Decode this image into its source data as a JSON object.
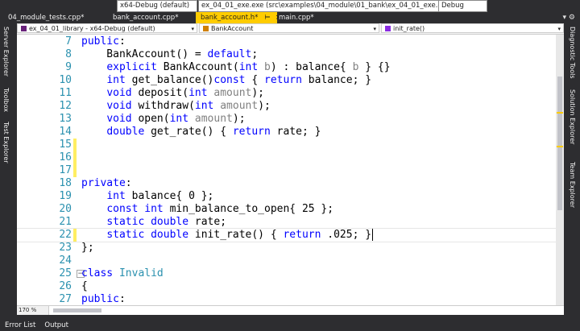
{
  "top_bar": {
    "platform": "x64-Debug (default)",
    "startup_item": "ex_04_01_exe.exe (src\\examples\\04_module\\01_bank\\ex_04_01_exe.exe)",
    "config": "Debug"
  },
  "tabs": [
    {
      "label": "04_module_tests.cpp*",
      "active": false
    },
    {
      "label": "bank_account.cpp*",
      "active": false
    },
    {
      "label": "bank_account.h*",
      "active": true,
      "pin": "⊨",
      "close": "×"
    },
    {
      "label": "main.cpp*",
      "active": false
    }
  ],
  "tab_overflow": "▾ ⚙",
  "left_sidebar": [
    "Server Explorer",
    "Toolbox",
    "Test Explorer"
  ],
  "right_sidebar": [
    "Diagnostic Tools",
    "Solution Explorer",
    "Team Explorer"
  ],
  "navigation": {
    "project": "ex_04_01_library - x64-Debug (default)",
    "class": "BankAccount",
    "member": "init_rate()"
  },
  "editor": {
    "lines": [
      {
        "n": "7",
        "tokens": [
          [
            "kw",
            "public"
          ],
          [
            "",
            ":"
          ]
        ]
      },
      {
        "n": "8",
        "tokens": [
          [
            "",
            "    BankAccount() = "
          ],
          [
            "kw",
            "default"
          ],
          [
            "",
            ";"
          ]
        ]
      },
      {
        "n": "9",
        "tokens": [
          [
            "",
            "    "
          ],
          [
            "kw",
            "explicit"
          ],
          [
            "",
            " BankAccount("
          ],
          [
            "kw",
            "int"
          ],
          [
            "",
            ""
          ],
          [
            "pm",
            " b"
          ],
          [
            "",
            ") : balance{ "
          ],
          [
            "pm",
            "b"
          ],
          [
            "",
            " } {}"
          ]
        ]
      },
      {
        "n": "10",
        "tokens": [
          [
            "",
            "    "
          ],
          [
            "kw",
            "int"
          ],
          [
            "",
            " get_balance()"
          ],
          [
            "kw",
            "const"
          ],
          [
            "",
            " { "
          ],
          [
            "kw",
            "return"
          ],
          [
            "",
            " balance; }"
          ]
        ]
      },
      {
        "n": "11",
        "tokens": [
          [
            "",
            "    "
          ],
          [
            "kw",
            "void"
          ],
          [
            "",
            " deposit("
          ],
          [
            "kw",
            "int"
          ],
          [
            "pm",
            " amount"
          ],
          [
            "",
            ");"
          ]
        ]
      },
      {
        "n": "12",
        "tokens": [
          [
            "",
            "    "
          ],
          [
            "kw",
            "void"
          ],
          [
            "",
            " withdraw("
          ],
          [
            "kw",
            "int"
          ],
          [
            "pm",
            " amount"
          ],
          [
            "",
            ");"
          ]
        ]
      },
      {
        "n": "13",
        "tokens": [
          [
            "",
            "    "
          ],
          [
            "kw",
            "void"
          ],
          [
            "",
            " open("
          ],
          [
            "kw",
            "int"
          ],
          [
            "pm",
            " amount"
          ],
          [
            "",
            ");"
          ]
        ]
      },
      {
        "n": "14",
        "tokens": [
          [
            "",
            "    "
          ],
          [
            "kw",
            "double"
          ],
          [
            "",
            " get_rate() { "
          ],
          [
            "kw",
            "return"
          ],
          [
            "",
            " rate; }"
          ]
        ]
      },
      {
        "n": "15",
        "tokens": []
      },
      {
        "n": "16",
        "tokens": []
      },
      {
        "n": "17",
        "tokens": []
      },
      {
        "n": "18",
        "tokens": [
          [
            "kw",
            "private"
          ],
          [
            "",
            ":"
          ]
        ]
      },
      {
        "n": "19",
        "tokens": [
          [
            "",
            "    "
          ],
          [
            "kw",
            "int"
          ],
          [
            "",
            " balance{ 0 };"
          ]
        ]
      },
      {
        "n": "20",
        "tokens": [
          [
            "",
            "    "
          ],
          [
            "kw",
            "const"
          ],
          [
            "",
            " "
          ],
          [
            "kw",
            "int"
          ],
          [
            "",
            " min_balance_to_open{ 25 };"
          ]
        ]
      },
      {
        "n": "21",
        "tokens": [
          [
            "",
            "    "
          ],
          [
            "kw",
            "static"
          ],
          [
            "",
            " "
          ],
          [
            "kw",
            "double"
          ],
          [
            "",
            " rate;"
          ]
        ]
      },
      {
        "n": "22",
        "tokens": [
          [
            "",
            "    "
          ],
          [
            "kw",
            "static"
          ],
          [
            "",
            " "
          ],
          [
            "kw",
            "double"
          ],
          [
            "",
            " init_rate() { "
          ],
          [
            "kw",
            "return"
          ],
          [
            "",
            " .025; }"
          ]
        ]
      },
      {
        "n": "23",
        "tokens": [
          [
            "",
            "};"
          ]
        ]
      },
      {
        "n": "24",
        "tokens": []
      },
      {
        "n": "25",
        "tokens": [
          [
            "kw",
            "class"
          ],
          [
            "",
            " "
          ],
          [
            "ty",
            "Invalid"
          ]
        ]
      },
      {
        "n": "26",
        "tokens": [
          [
            "",
            "{"
          ]
        ]
      },
      {
        "n": "27",
        "tokens": [
          [
            "kw",
            "public"
          ],
          [
            "",
            ":"
          ]
        ]
      }
    ]
  },
  "zoom": "170 %",
  "status_bar": [
    "Error List",
    "Output"
  ],
  "colors": {
    "active_tab": "#ffcc00",
    "keyword": "#0000ff",
    "type": "#2b91af",
    "line_number": "#2b91af",
    "change_bar": "#ffee62"
  }
}
